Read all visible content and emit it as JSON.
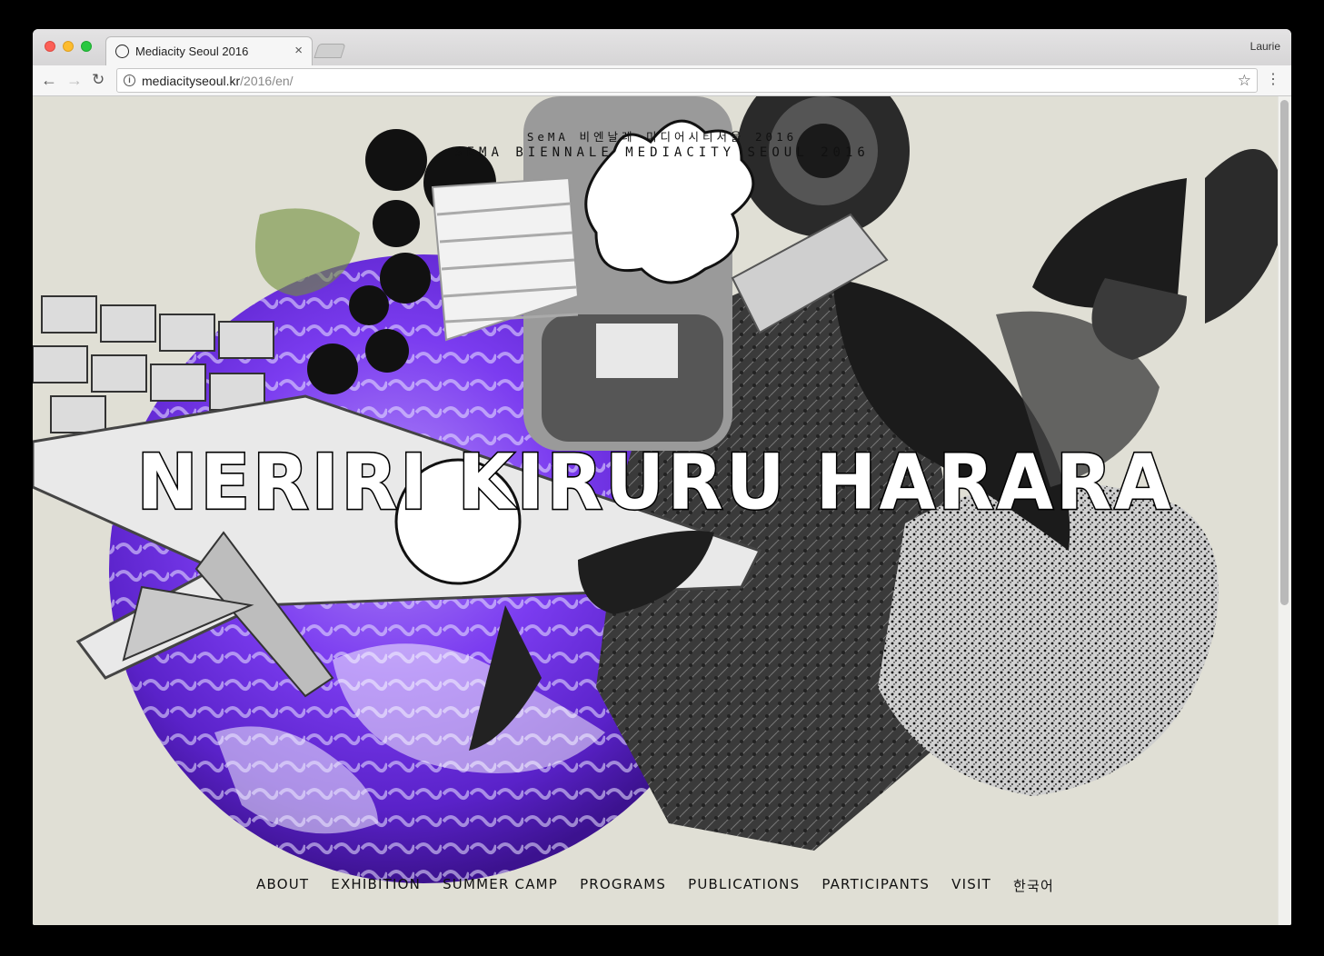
{
  "browser": {
    "tab_title": "Mediacity Seoul 2016",
    "tab_close": "×",
    "profile_name": "Laurie",
    "url_host": "mediacityseoul.kr",
    "url_path": "/2016/en/",
    "icons": {
      "back": "arrow-left",
      "forward": "arrow-right",
      "reload": "reload",
      "info": "info-circle",
      "bookmark": "star",
      "menu": "vertical-dots"
    }
  },
  "page": {
    "kicker_ko": "SeMA 비엔날레 미디어시티서울 2016",
    "kicker_en": "SEMA BIENNALE MEDIACITY SEOUL 2016",
    "headline": "NERIRI KIRURU HARARA",
    "nav": [
      "ABOUT",
      "EXHIBITION",
      "SUMMER CAMP",
      "PROGRAMS",
      "PUBLICATIONS",
      "PARTICIPANTS",
      "VISIT",
      "한국어"
    ],
    "colors": {
      "background": "#e0dfd5",
      "globe_purple": "#7b3cf0",
      "text": "#111111"
    }
  }
}
